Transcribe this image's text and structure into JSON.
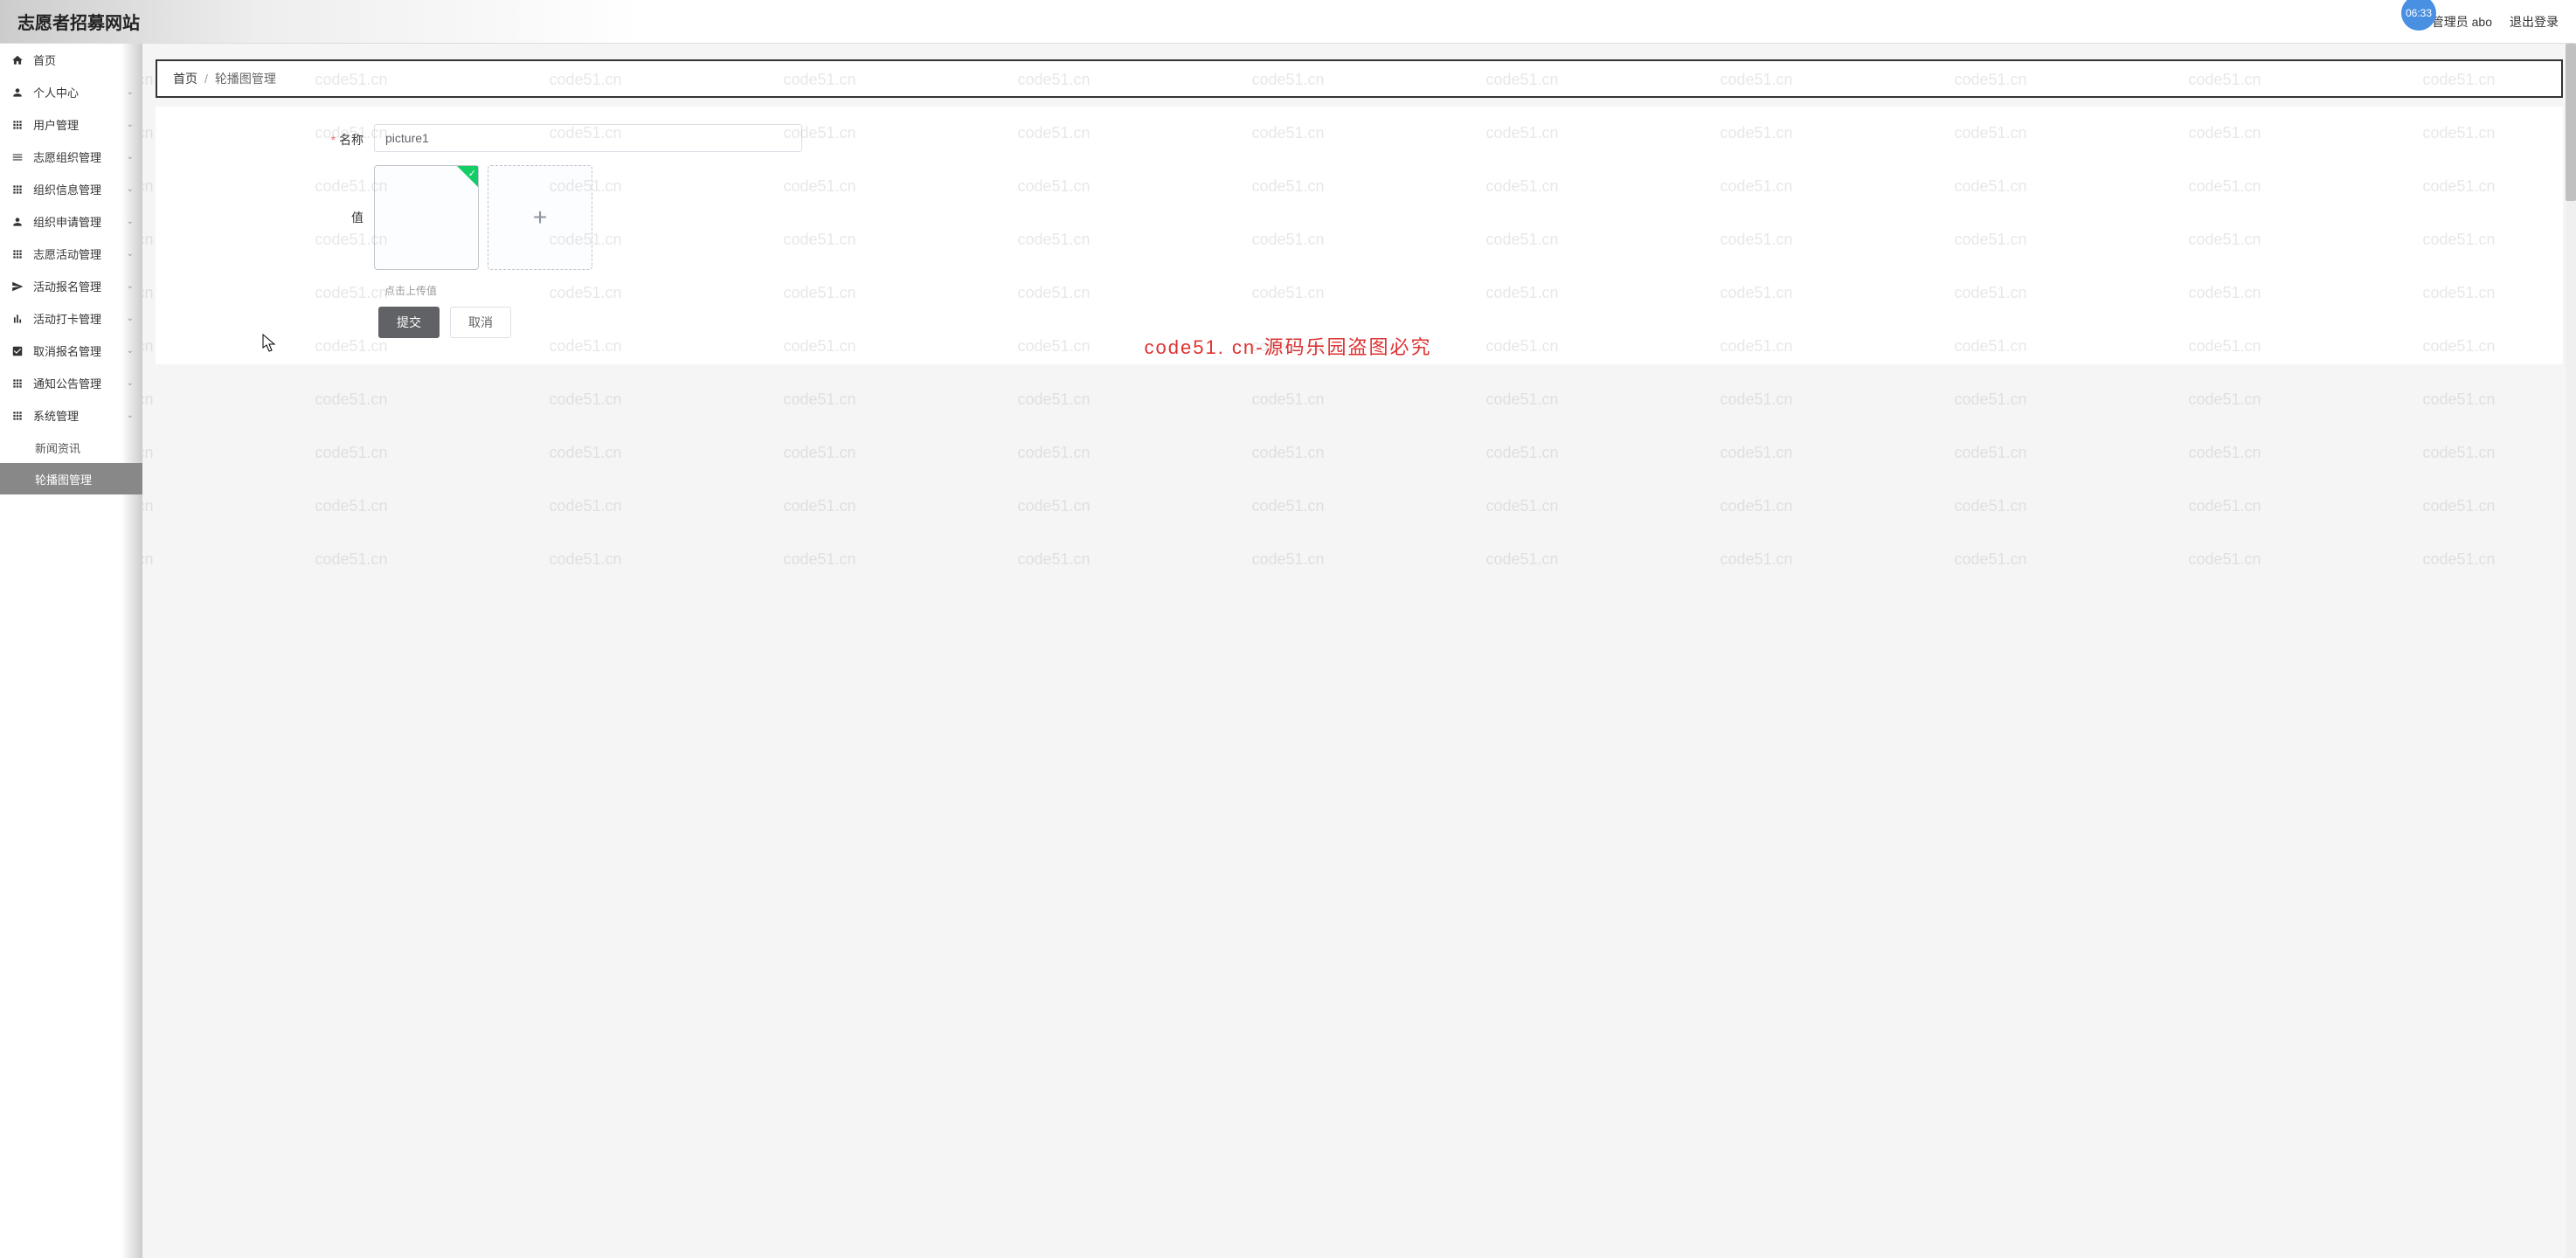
{
  "header": {
    "title": "志愿者招募网站",
    "time_badge": "06:33",
    "user_prefix": "管理员",
    "user_name": "abo",
    "logout": "退出登录"
  },
  "sidebar": {
    "items": [
      {
        "icon": "home",
        "label": "首页",
        "expandable": false
      },
      {
        "icon": "user",
        "label": "个人中心",
        "expandable": true
      },
      {
        "icon": "grid",
        "label": "用户管理",
        "expandable": true
      },
      {
        "icon": "bars",
        "label": "志愿组织管理",
        "expandable": true
      },
      {
        "icon": "grid",
        "label": "组织信息管理",
        "expandable": true
      },
      {
        "icon": "user",
        "label": "组织申请管理",
        "expandable": true
      },
      {
        "icon": "grid",
        "label": "志愿活动管理",
        "expandable": true
      },
      {
        "icon": "send",
        "label": "活动报名管理",
        "expandable": true
      },
      {
        "icon": "chart",
        "label": "活动打卡管理",
        "expandable": true
      },
      {
        "icon": "check",
        "label": "取消报名管理",
        "expandable": true
      },
      {
        "icon": "grid",
        "label": "通知公告管理",
        "expandable": true
      },
      {
        "icon": "grid",
        "label": "系统管理",
        "expandable": true
      }
    ],
    "subs": [
      {
        "label": "新闻资讯",
        "active": false
      },
      {
        "label": "轮播图管理",
        "active": true
      }
    ]
  },
  "breadcrumb": {
    "home": "首页",
    "sep": "/",
    "current": "轮播图管理"
  },
  "form": {
    "name_label": "名称",
    "name_value": "picture1",
    "value_label": "值",
    "upload_hint": "点击上传值",
    "submit": "提交",
    "cancel": "取消"
  },
  "watermark": {
    "text": "code51.cn",
    "banner": "code51. cn-源码乐园盗图必究"
  }
}
